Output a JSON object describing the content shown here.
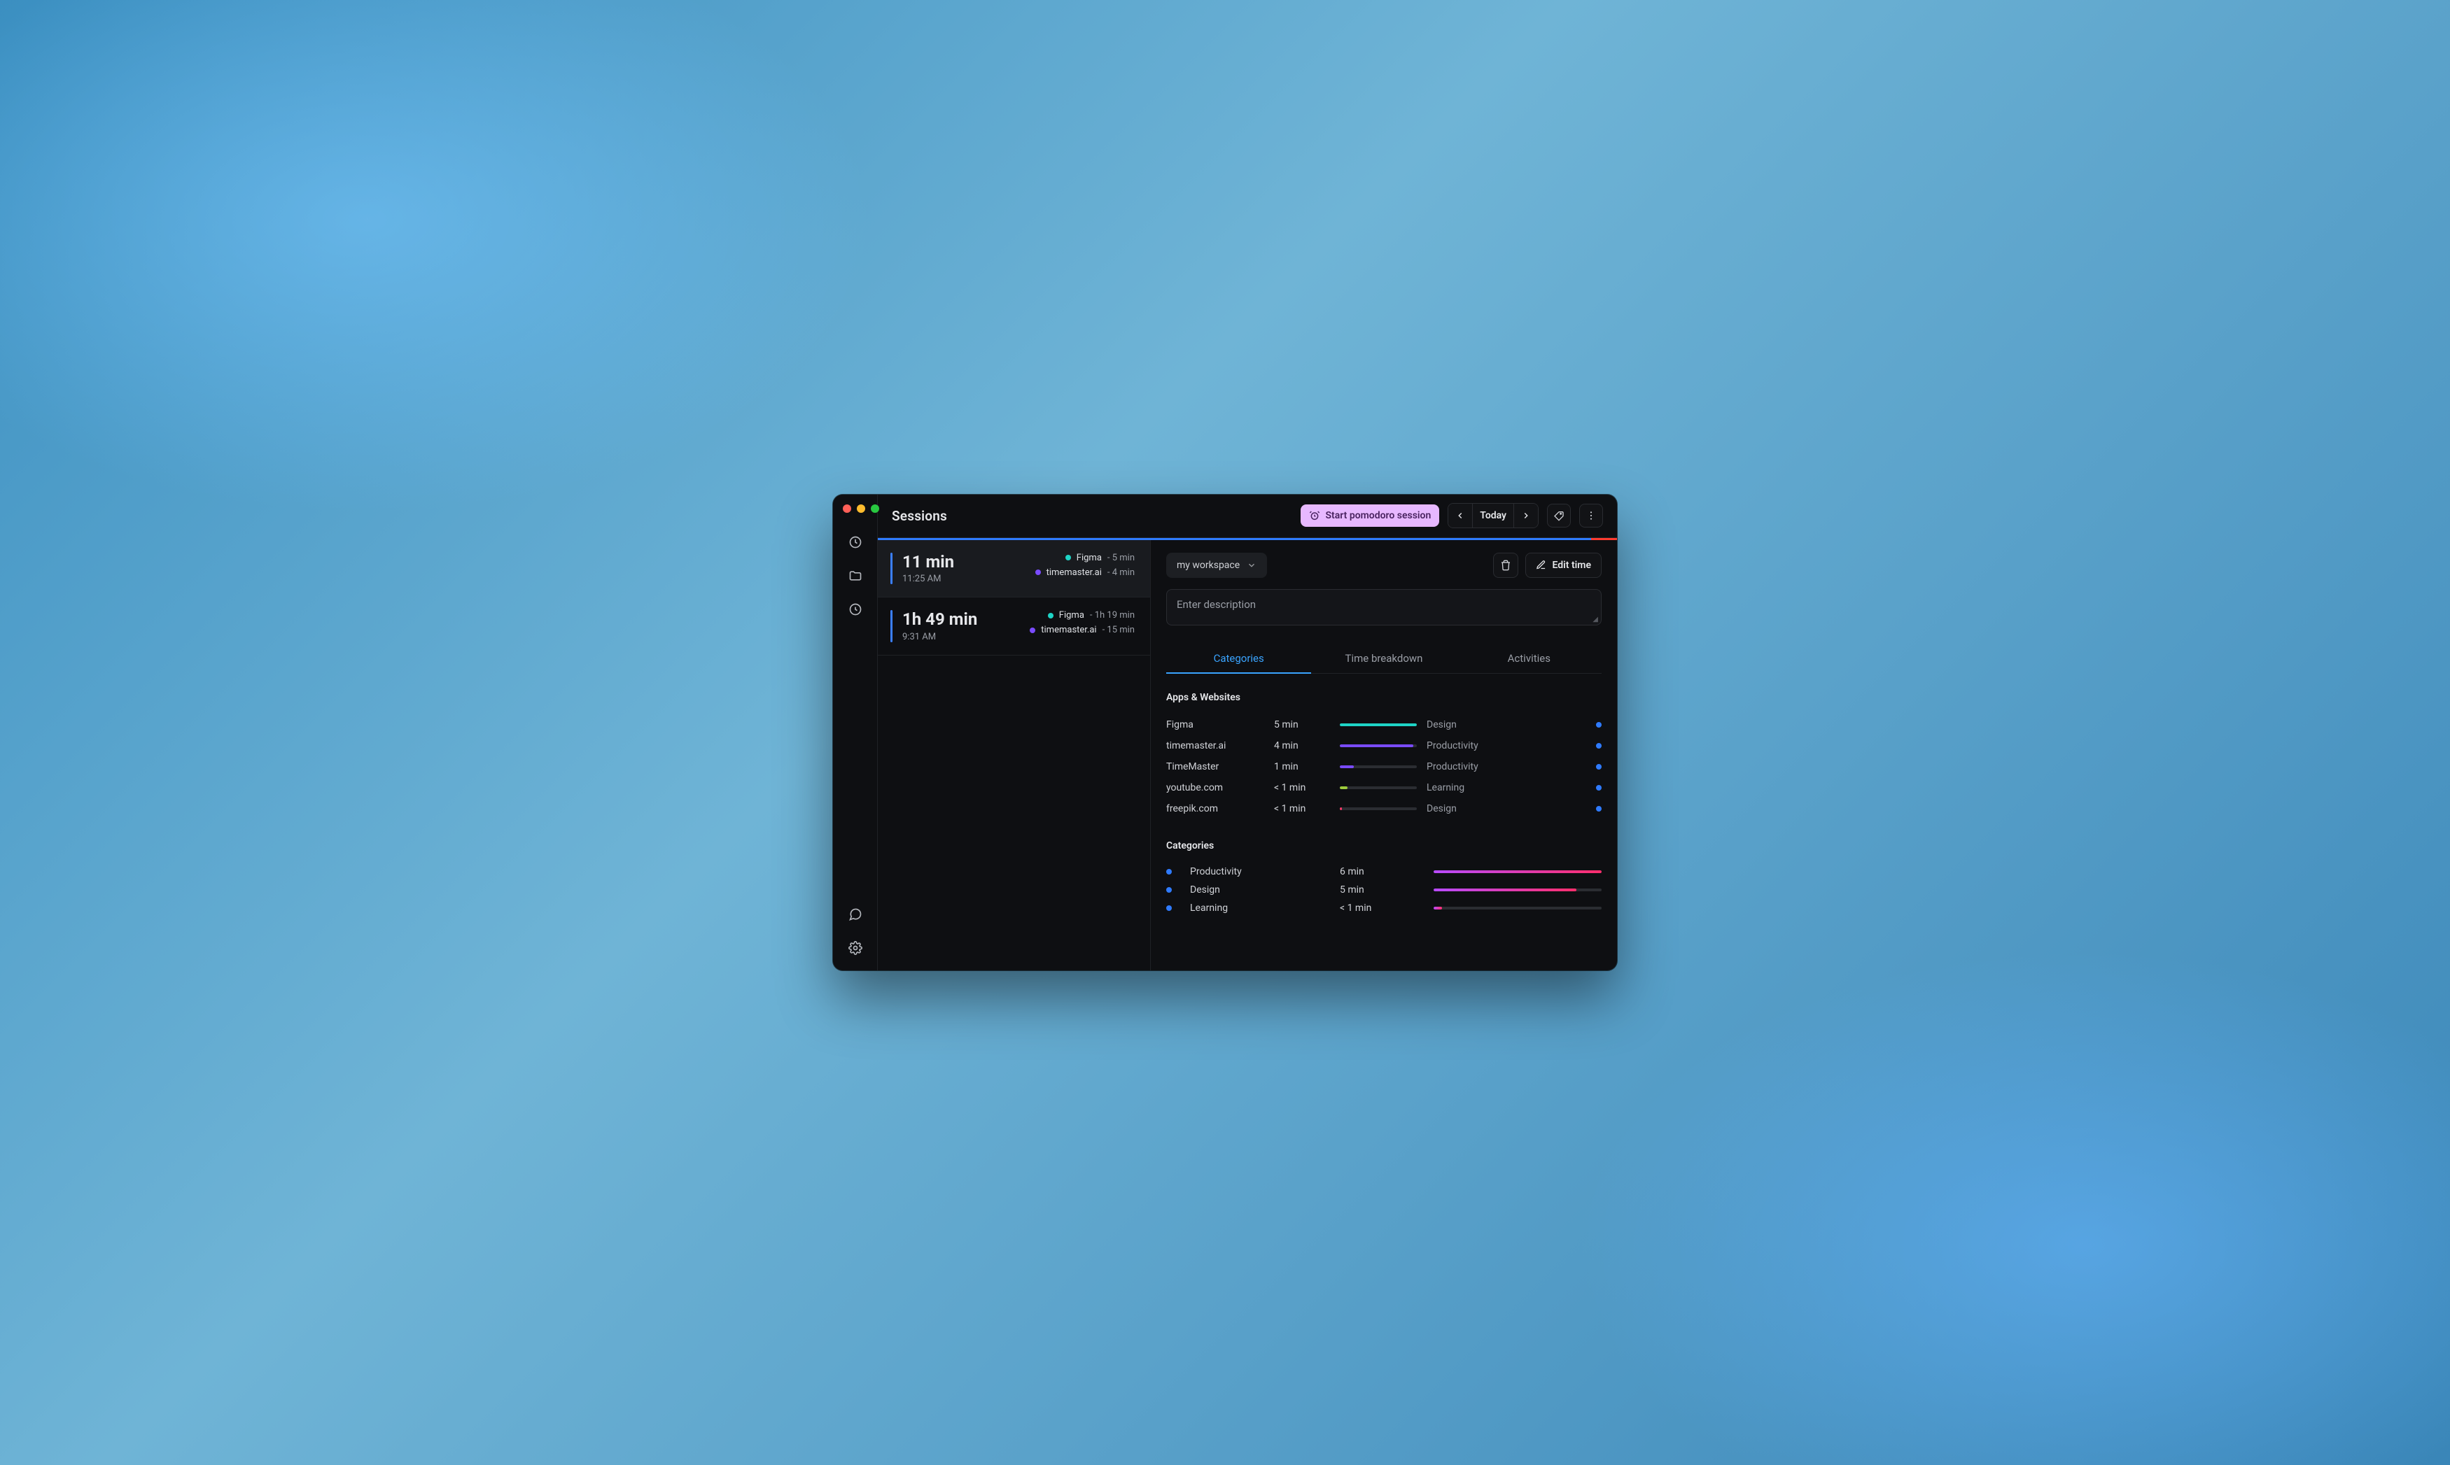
{
  "header": {
    "title": "Sessions",
    "pomodoro_label": "Start pomodoro session",
    "date_label": "Today"
  },
  "sessions": [
    {
      "duration": "11 min",
      "started": "11:25 AM",
      "items": [
        {
          "color": "cyan",
          "app": "Figma",
          "time": "5 min"
        },
        {
          "color": "purple",
          "app": "timemaster.ai",
          "time": "4 min"
        }
      ],
      "active": true
    },
    {
      "duration": "1h 49 min",
      "started": "9:31 AM",
      "items": [
        {
          "color": "cyan",
          "app": "Figma",
          "time": "1h 19 min"
        },
        {
          "color": "purple",
          "app": "timemaster.ai",
          "time": "15 min"
        }
      ],
      "active": false
    }
  ],
  "detail": {
    "workspace_label": "my workspace",
    "delete_tooltip": "Delete",
    "edit_label": "Edit time",
    "description_placeholder": "Enter description",
    "tabs": {
      "categories": "Categories",
      "time_breakdown": "Time breakdown",
      "activities": "Activities"
    },
    "apps_section_title": "Apps & Websites",
    "apps": [
      {
        "name": "Figma",
        "time": "5 min",
        "pct": 100,
        "color": "#1ed4c6",
        "category": "Design"
      },
      {
        "name": "timemaster.ai",
        "time": "4 min",
        "pct": 95,
        "color": "#7a4bff",
        "category": "Productivity"
      },
      {
        "name": "TimeMaster",
        "time": "1 min",
        "pct": 18,
        "color": "#7a4bff",
        "category": "Productivity"
      },
      {
        "name": "youtube.com",
        "time": "< 1 min",
        "pct": 10,
        "color": "#9ecc3c",
        "category": "Learning"
      },
      {
        "name": "freepik.com",
        "time": "< 1 min",
        "pct": 3,
        "color": "#ff3b6b",
        "category": "Design"
      }
    ],
    "categories_section_title": "Categories",
    "categories": [
      {
        "name": "Productivity",
        "time": "6 min",
        "pct": 100
      },
      {
        "name": "Design",
        "time": "5 min",
        "pct": 85
      },
      {
        "name": "Learning",
        "time": "< 1 min",
        "pct": 5
      }
    ]
  }
}
